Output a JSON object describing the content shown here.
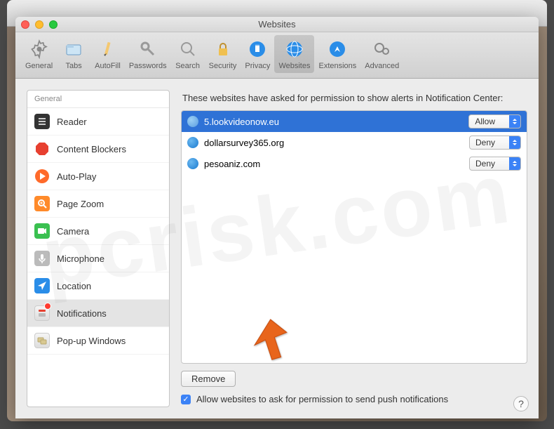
{
  "window": {
    "title": "Websites"
  },
  "toolbar": {
    "items": [
      {
        "label": "General"
      },
      {
        "label": "Tabs"
      },
      {
        "label": "AutoFill"
      },
      {
        "label": "Passwords"
      },
      {
        "label": "Search"
      },
      {
        "label": "Security"
      },
      {
        "label": "Privacy"
      },
      {
        "label": "Websites"
      },
      {
        "label": "Extensions"
      },
      {
        "label": "Advanced"
      }
    ]
  },
  "sidebar": {
    "header": "General",
    "items": [
      {
        "label": "Reader"
      },
      {
        "label": "Content Blockers"
      },
      {
        "label": "Auto-Play"
      },
      {
        "label": "Page Zoom"
      },
      {
        "label": "Camera"
      },
      {
        "label": "Microphone"
      },
      {
        "label": "Location"
      },
      {
        "label": "Notifications"
      },
      {
        "label": "Pop-up Windows"
      }
    ]
  },
  "main": {
    "header": "These websites have asked for permission to show alerts in Notification Center:",
    "sites": [
      {
        "name": "5.lookvideonow.eu",
        "permission": "Allow"
      },
      {
        "name": "dollarsurvey365.org",
        "permission": "Deny"
      },
      {
        "name": "pesoaniz.com",
        "permission": "Deny"
      }
    ],
    "remove_label": "Remove",
    "checkbox_label": "Allow websites to ask for permission to send push notifications"
  },
  "help": "?"
}
